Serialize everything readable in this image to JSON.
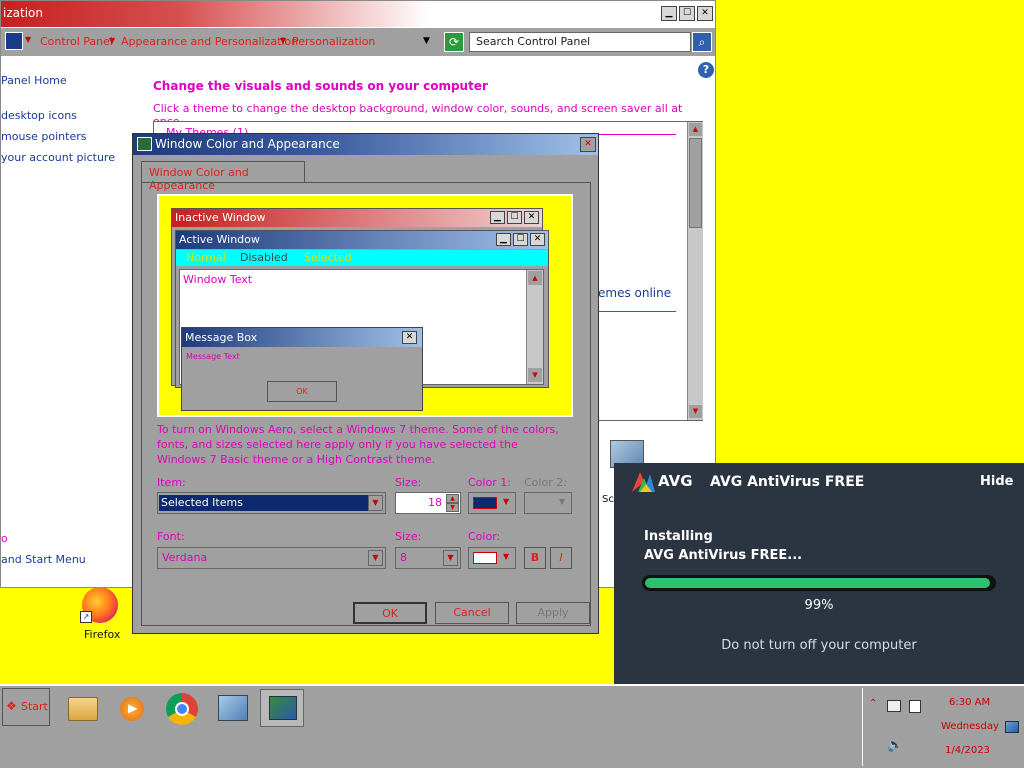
{
  "control_panel": {
    "title": "ization",
    "breadcrumbs": [
      "Control Panel",
      "Appearance and Personalization",
      "Personalization"
    ],
    "search_placeholder": "Search Control Panel",
    "left_links": [
      "Panel Home",
      "desktop icons",
      "mouse pointers",
      "your account picture"
    ],
    "left_links_bottom": [
      "o",
      "and Start Menu"
    ],
    "heading": "Change the visuals and sounds on your computer",
    "subheading": "Click a theme to change the desktop background, window color, sounds, and screen saver all at once.",
    "my_themes": "My Themes (1)",
    "online_themes_link": "emes online"
  },
  "dialog": {
    "title": "Window Color and Appearance",
    "tab_label": "Window Color and Appearance",
    "preview": {
      "inactive_title": "Inactive Window",
      "active_title": "Active Window",
      "menu_normal": "Normal",
      "menu_disabled": "Disabled",
      "menu_selected": "Selected",
      "window_text": "Window Text",
      "msgbox_title": "Message Box",
      "msgbox_text": "Message Text",
      "msgbox_ok": "OK"
    },
    "info_text": "To turn on Windows Aero, select a Windows 7 theme.  Some of the colors, fonts, and sizes selected here apply only if you have selected the Windows 7 Basic theme or a High Contrast theme.",
    "item_label": "Item:",
    "item_value": "Selected Items",
    "size_label": "Size:",
    "size_value": "18",
    "color1_label": "Color 1:",
    "color2_label": "Color 2:",
    "font_label": "Font:",
    "font_value": "Verdana",
    "font_size_label": "Size:",
    "font_size_value": "8",
    "font_color_label": "Color:",
    "bold_label": "B",
    "italic_label": "I",
    "ok_label": "OK",
    "cancel_label": "Cancel",
    "apply_label": "Apply",
    "color1_value": "#0d2a6e"
  },
  "desktop": {
    "firefox_label": "Firefox",
    "partial_icon_label": "Sc"
  },
  "avg": {
    "brand": "AVG",
    "title": "AVG AntiVirus FREE",
    "hide_label": "Hide",
    "status_line1": "Installing",
    "status_line2": "AVG AntiVirus FREE...",
    "progress_percent": 99,
    "progress_text": "99%",
    "notice": "Do not turn off your computer",
    "accent": "#2fbf71"
  },
  "taskbar": {
    "start_label": "Start",
    "apps": [
      "explorer-icon",
      "media-player-icon",
      "chrome-icon",
      "control-panel-icon",
      "personalization-icon"
    ],
    "clock_time": "6:30 AM",
    "clock_day": "Wednesday",
    "clock_date": "1/4/2023"
  }
}
